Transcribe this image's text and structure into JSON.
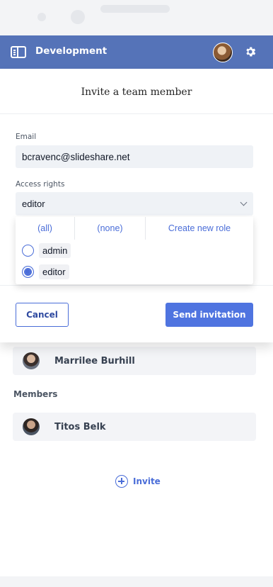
{
  "app": {
    "title": "Development"
  },
  "header": {
    "settings_icon": "gear-icon",
    "sidebar_icon": "sidebar-toggle-icon"
  },
  "background": {
    "owner": {
      "name": "Marrilee Burhill"
    },
    "members_label": "Members",
    "members": [
      {
        "name": "Titos Belk"
      }
    ],
    "invite_label": "Invite"
  },
  "modal": {
    "title": "Invite a team member",
    "email": {
      "label": "Email",
      "value": "bcravenc@slideshare.net"
    },
    "access": {
      "label": "Access rights",
      "selected": "editor"
    },
    "dropdown": {
      "actions": [
        "(all)",
        "(none)",
        "Create new role"
      ],
      "options": [
        {
          "label": "admin",
          "checked": false
        },
        {
          "label": "editor",
          "checked": true
        }
      ]
    },
    "cancel_label": "Cancel",
    "send_label": "Send invitation"
  },
  "colors": {
    "header": "#5573b8",
    "accent": "#4f74e0",
    "link": "#4a6dd8"
  }
}
